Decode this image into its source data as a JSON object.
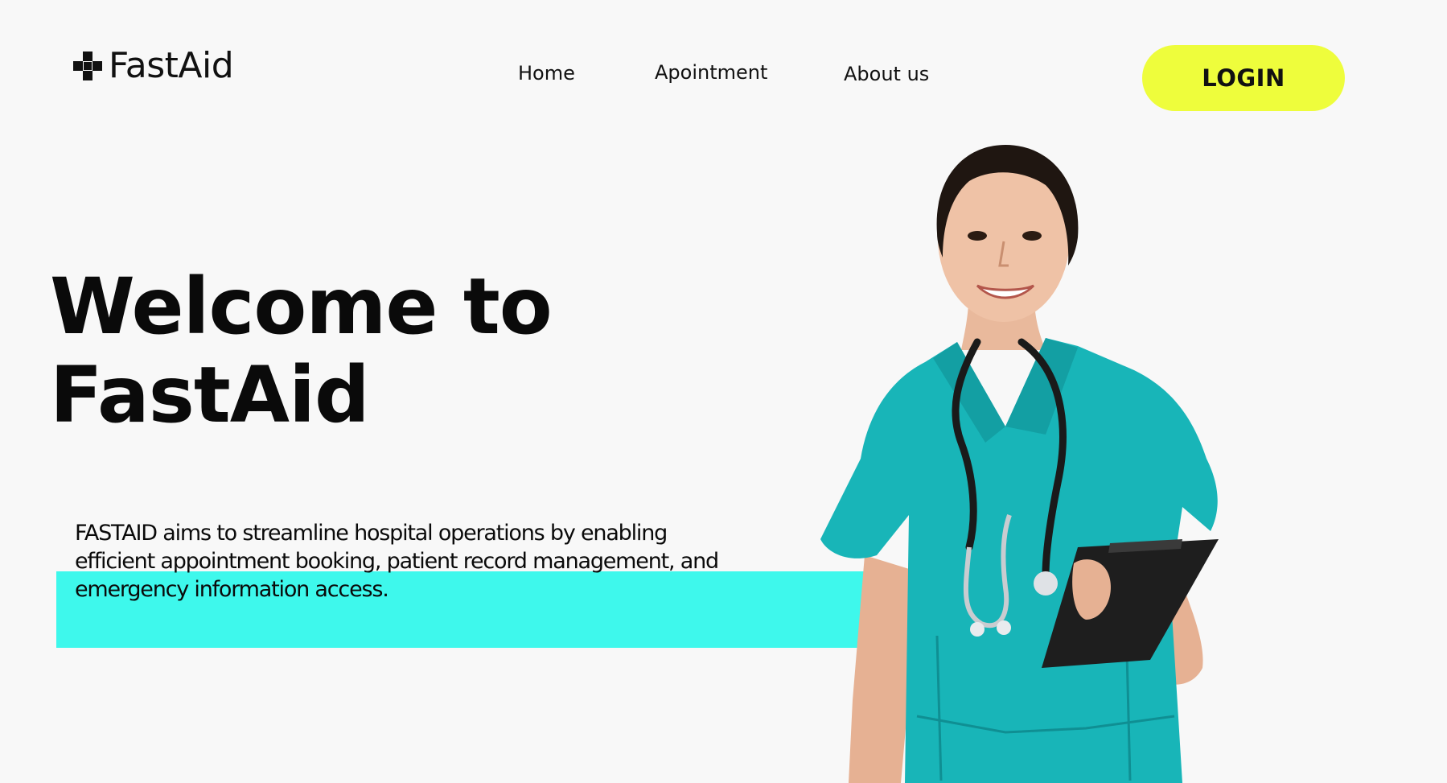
{
  "brand": {
    "name": "FastAid",
    "logo_icon": "medical-cross-icon"
  },
  "nav": {
    "items": [
      {
        "label": "Home"
      },
      {
        "label": "Apointment"
      },
      {
        "label": "About us"
      }
    ]
  },
  "header": {
    "login_label": "LOGIN"
  },
  "hero": {
    "title_line1": "Welcome to",
    "title_line2": "FastAid",
    "description": "FASTAID aims to streamline hospital operations by enabling efficient appointment booking, patient record management, and emergency information access.",
    "image": "doctor-illustration"
  },
  "colors": {
    "background": "#f8f8f8",
    "login_button": "#eefd3c",
    "accent_band": "#3ef8ec",
    "scrubs": "#18b5b8",
    "text": "#0a0a0a"
  }
}
